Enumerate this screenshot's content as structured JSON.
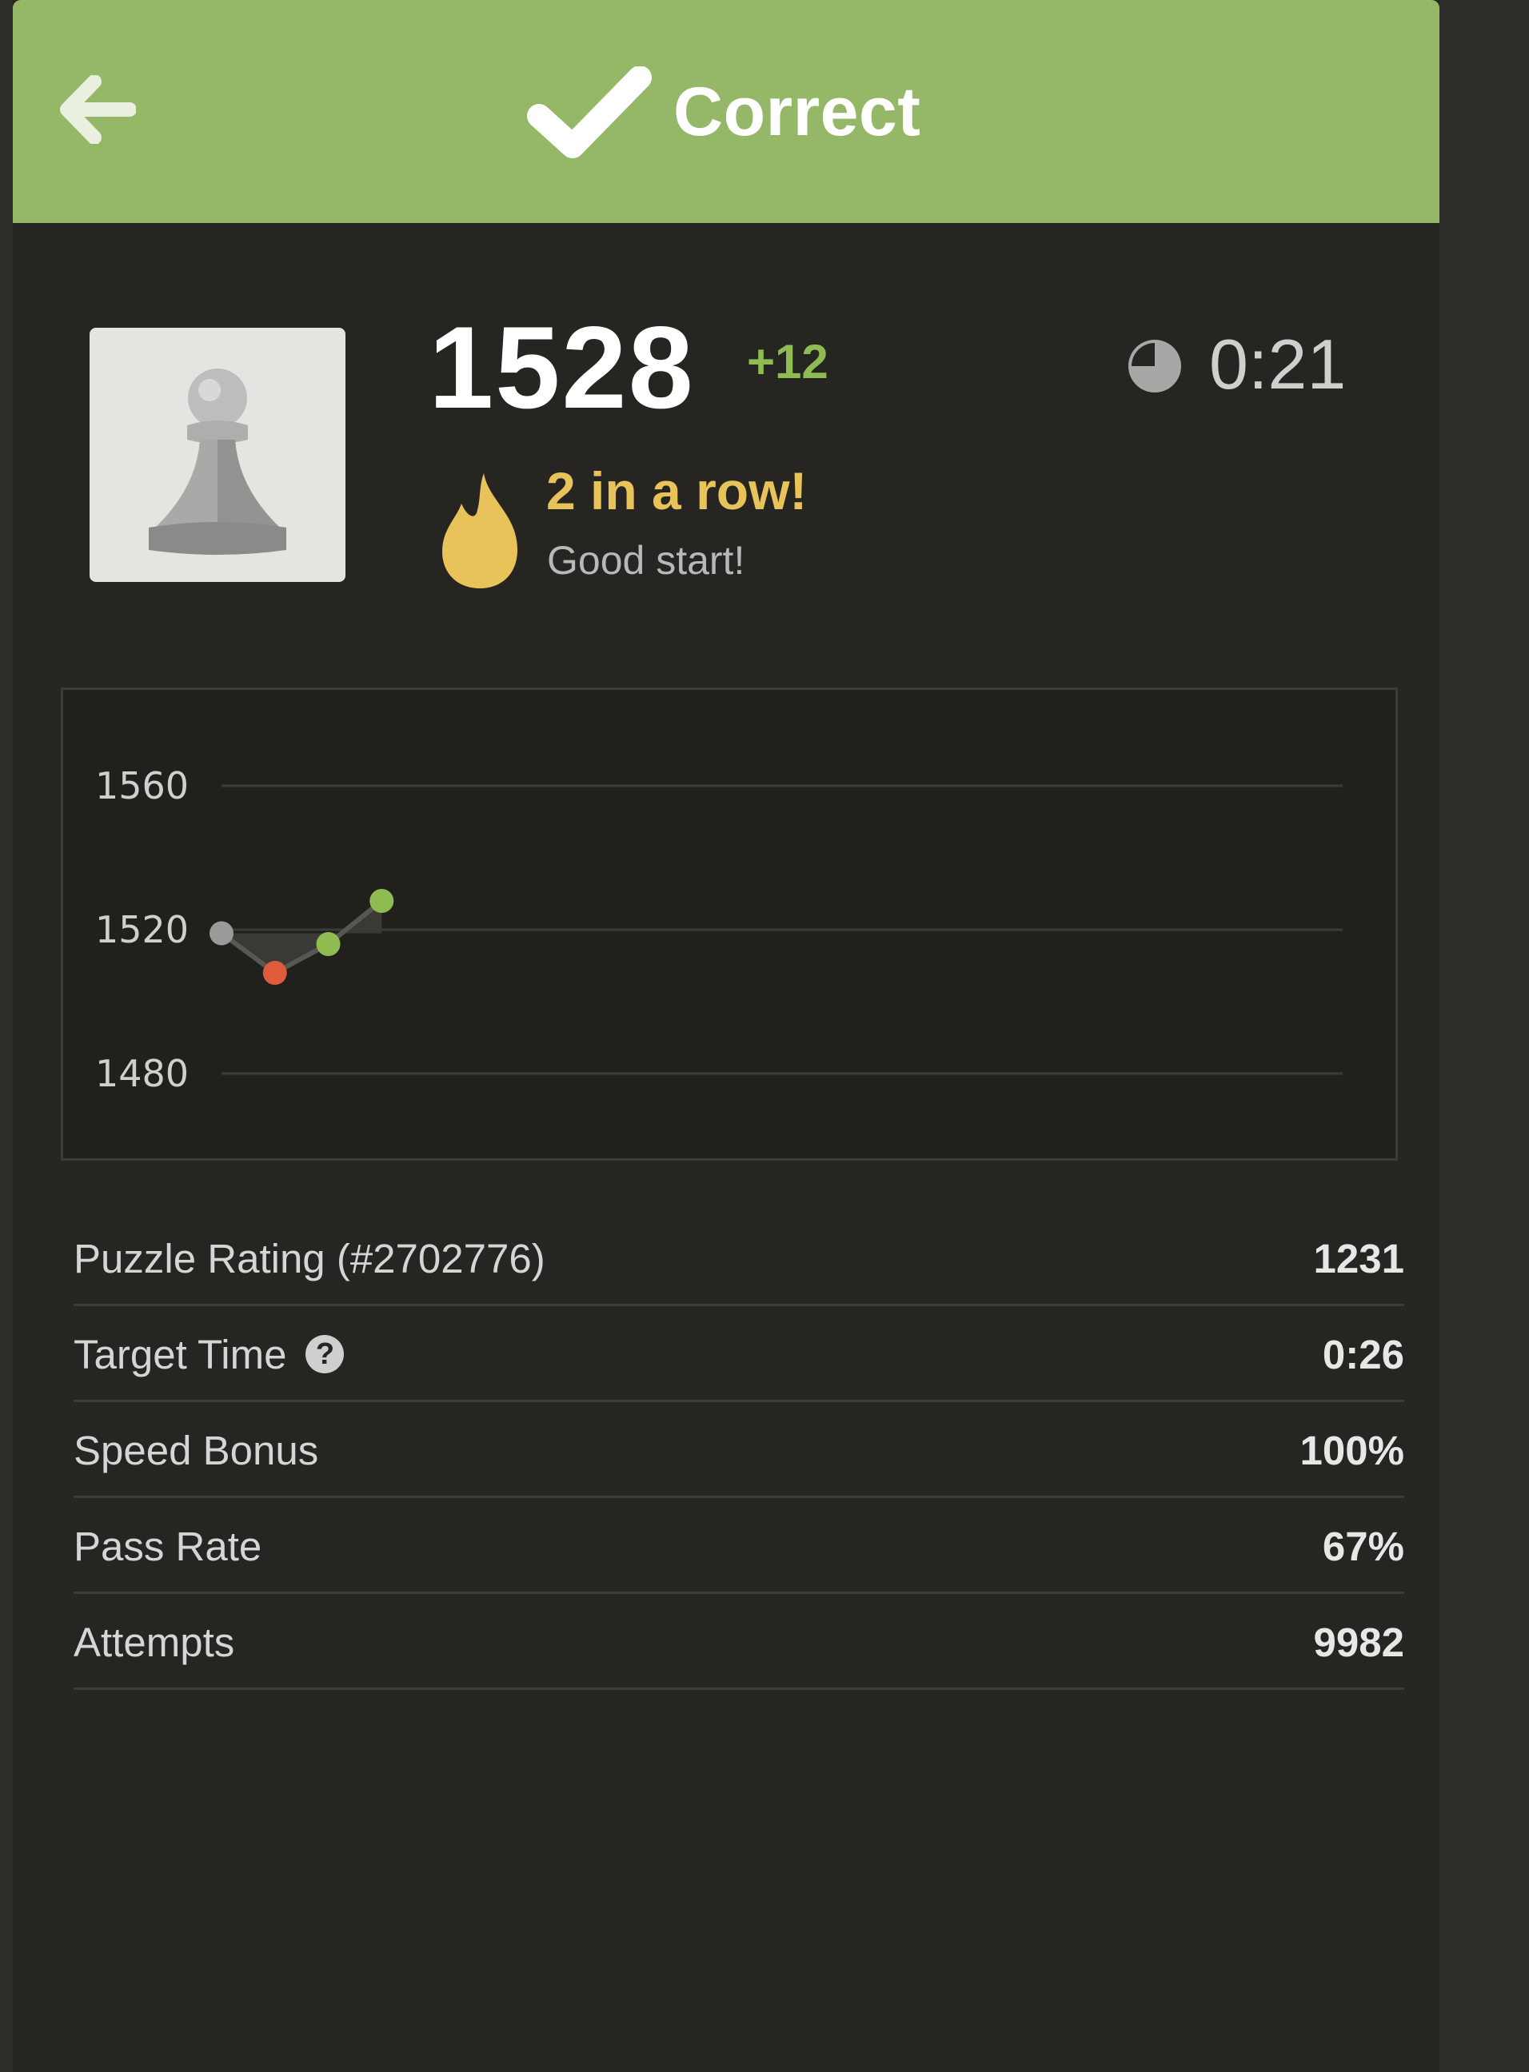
{
  "header": {
    "title": "Correct",
    "back_icon": "arrow-left-icon",
    "check_icon": "checkmark-icon",
    "background": "#95b868"
  },
  "player": {
    "avatar_icon": "pawn-icon",
    "rating": "1528",
    "rating_change": "+12",
    "timer": "0:21",
    "timer_icon": "clock-icon",
    "streak_title": "2 in a row!",
    "streak_subtitle": "Good start!",
    "streak_icon": "flame-icon",
    "colors": {
      "positive": "#8fbc52",
      "streak": "#e8c35a",
      "negative": "#e05a3c"
    }
  },
  "chart_data": {
    "type": "line",
    "x": [
      1,
      2,
      3,
      4
    ],
    "series": [
      {
        "values": [
          1519,
          1508,
          1516,
          1528
        ],
        "point_results": [
          "start",
          "incorrect",
          "correct",
          "correct"
        ]
      }
    ],
    "yticks": [
      1560,
      1520,
      1480
    ],
    "ylim": [
      1480,
      1560
    ],
    "xlim": [
      1,
      22
    ],
    "grid": true,
    "point_colors": {
      "start": "#9a9a9a",
      "incorrect": "#e05a3c",
      "correct": "#8fbc52"
    }
  },
  "stats": [
    {
      "label": "Puzzle Rating (#2702776)",
      "value": "1231",
      "has_help": false
    },
    {
      "label": "Target Time",
      "value": "0:26",
      "has_help": true
    },
    {
      "label": "Speed Bonus",
      "value": "100%",
      "has_help": false
    },
    {
      "label": "Pass Rate",
      "value": "67%",
      "has_help": false
    },
    {
      "label": "Attempts",
      "value": "9982",
      "has_help": false
    }
  ]
}
